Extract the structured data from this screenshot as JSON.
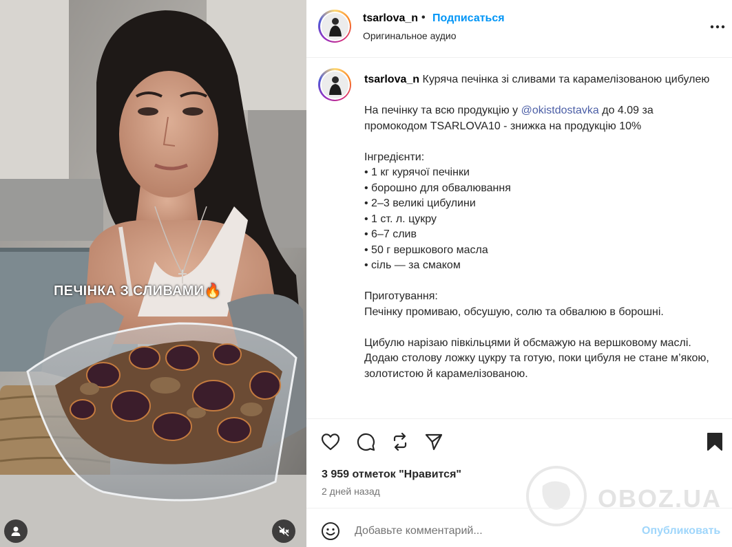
{
  "media": {
    "overlay_text": "ПЕЧІНКА З СЛИВАМИ🔥"
  },
  "header": {
    "username": "tsarlova_n",
    "separator": "•",
    "follow_label": "Подписаться",
    "audio_label": "Оригинальное аудио"
  },
  "caption": {
    "username": "tsarlova_n",
    "title": " Куряча печінка зі сливами та карамелізованою цибулею",
    "promo_before": "На печінку та всю продукцію у ",
    "promo_mention": "@okistdostavka",
    "promo_after": " до 4.09 за промокодом TSARLOVA10 - знижка на продукцію 10%",
    "ingredients_heading": "Інгредієнти:",
    "ingredients": [
      "• 1 кг курячої печінки",
      "• борошно для обвалювання",
      "• 2–3 великі цибулини",
      "• 1 ст. л. цукру",
      "• 6–7 слив",
      "• 50 г вершкового масла",
      "• сіль — за смаком"
    ],
    "preparation_heading": "Приготування:",
    "step1": "Печінку промиваю, обсушую, солю та обвалюю в борошні.",
    "step2": "Цибулю нарізаю півкільцями й обсмажую на вершковому маслі. Додаю столову ложку цукру та готую, поки цибуля не стане м’якою, золотистою й карамелізованою."
  },
  "actions": {
    "likes_text": "3 959 отметок \"Нравится\"",
    "time_ago": "2 дней назад"
  },
  "comment": {
    "placeholder": "Добавьте комментарий...",
    "post_label": "Опубликовать"
  },
  "watermark": {
    "text": "OBOZ.UA"
  },
  "colors": {
    "link_blue": "#0095f6",
    "mention_blue": "#4b5ea6",
    "post_disabled": "#9fd6fb"
  }
}
